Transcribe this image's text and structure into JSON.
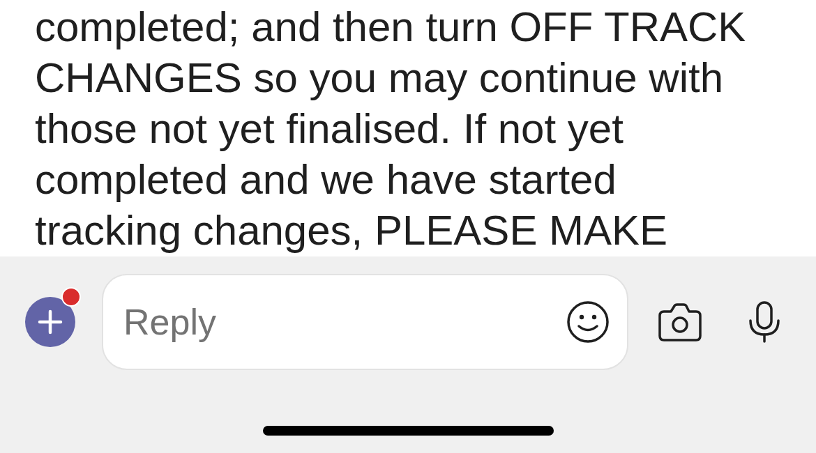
{
  "message": {
    "text": "completed; and then turn OFF TRACK\nCHANGES so you may continue with\nthose not yet finalised. If not yet\ncompleted and we have started\ntracking changes, PLEASE MAKE"
  },
  "composer": {
    "add_button": {
      "notification": true
    },
    "reply_field": {
      "placeholder": "Reply"
    }
  }
}
